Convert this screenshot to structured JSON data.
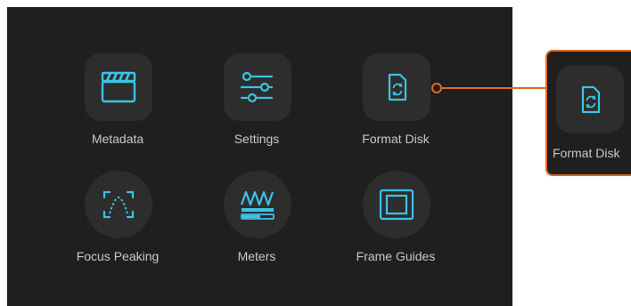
{
  "colors": {
    "panel": "#1f1f1f",
    "tile": "#2d2d2d",
    "icon_accent": "#3cc3e6",
    "label": "#c8c8c8",
    "callout": "#e06a20"
  },
  "menu": {
    "items": [
      {
        "label": "Metadata",
        "icon": "clapperboard-icon"
      },
      {
        "label": "Settings",
        "icon": "sliders-icon"
      },
      {
        "label": "Format Disk",
        "icon": "format-disk-icon"
      },
      {
        "label": "Focus Peaking",
        "icon": "focus-peaking-icon"
      },
      {
        "label": "Meters",
        "icon": "meters-icon"
      },
      {
        "label": "Frame Guides",
        "icon": "frame-guides-icon"
      }
    ]
  },
  "callout": {
    "label": "Format Disk",
    "icon": "format-disk-icon"
  }
}
